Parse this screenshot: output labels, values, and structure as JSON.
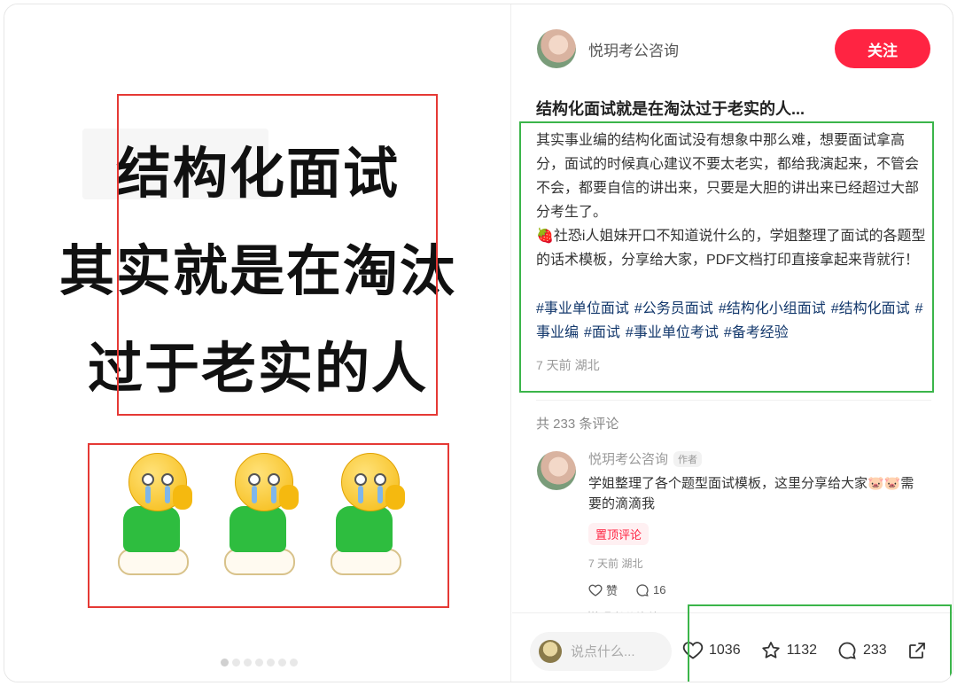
{
  "image": {
    "lines": [
      "结构化面试",
      "其实就是在淘汰",
      "过于老实的人"
    ],
    "carousel_dots": 7,
    "active_dot": 1
  },
  "author": {
    "name": "悦玥考公咨询",
    "follow_label": "关注"
  },
  "note": {
    "title": "结构化面试就是在淘汰过于老实的人...",
    "paragraph1": "其实事业编的结构化面试没有想象中那么难，想要面试拿高分，面试的时候真心建议不要太老实，都给我演起来，不管会不会，都要自信的讲出来，只要是大胆的讲出来已经超过大部分考生了。",
    "paragraph2": "🍓社恐i人姐妹开口不知道说什么的，学姐整理了面试的各题型的话术模板，分享给大家，PDF文档打印直接拿起来背就行！",
    "tags": [
      "#事业单位面试",
      "#公务员面试",
      "#结构化小组面试",
      "#结构化面试",
      "#事业编",
      "#面试",
      "#事业单位考试",
      "#备考经验"
    ],
    "meta": "7 天前 湖北"
  },
  "comments": {
    "count_label": "共 233 条评论",
    "items": [
      {
        "name": "悦玥考公咨询",
        "badge": "作者",
        "text": "学姐整理了各个题型面试模板，这里分享给大家🐷🐷需要的滴滴我",
        "pin": "置顶评论",
        "meta": "7 天前 湖北",
        "like_label": "赞",
        "reply_count": "16"
      }
    ],
    "peek_text": "悦玥考公咨询"
  },
  "bottom": {
    "input_placeholder": "说点什么...",
    "likes": "1036",
    "stars": "1132",
    "comments": "233"
  },
  "colors": {
    "brand_red": "#ff2442",
    "tag_blue": "#13386c",
    "annotation_red": "#e53935",
    "annotation_green": "#3bb54a"
  }
}
